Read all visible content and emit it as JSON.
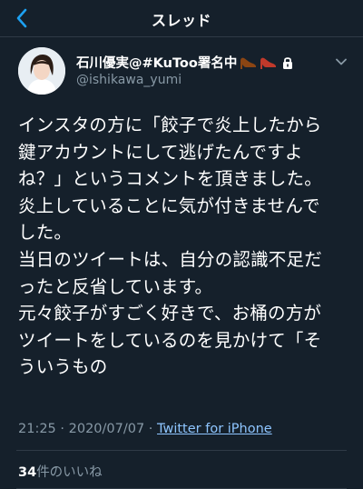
{
  "header": {
    "title": "スレッド"
  },
  "user": {
    "display_name": "石川優実@#KuToo署名中",
    "handle": "@ishikawa_yumi"
  },
  "tweet": {
    "lines": [
      "インスタの方に「餃子で炎上したから",
      "鍵アカウントにして逃げたんですよ",
      "ね？」というコメントを頂きました。",
      "炎上していることに気が付きませんで",
      "した。",
      "当日のツイートは、自分の認識不足だ",
      "ったと反省しています。",
      "元々餃子がすごく好きで、お桶の方が",
      "ツイートをしているのを見かけて「そ",
      "ういうもの"
    ],
    "timestamp": "21:25 · 2020/07/07 · ",
    "source": "Twitter for iPhone"
  },
  "likes": {
    "count": "34",
    "label": "件のいいね"
  },
  "icons": {
    "back": "chevron-left-icon",
    "lock": "lock-icon",
    "caret": "chevron-down-icon",
    "shoes": "high-heel-icon"
  },
  "colors": {
    "background": "#15202b",
    "accent": "#1da1f2",
    "secondary_text": "#8899a6",
    "shoe": "#8b4513"
  }
}
